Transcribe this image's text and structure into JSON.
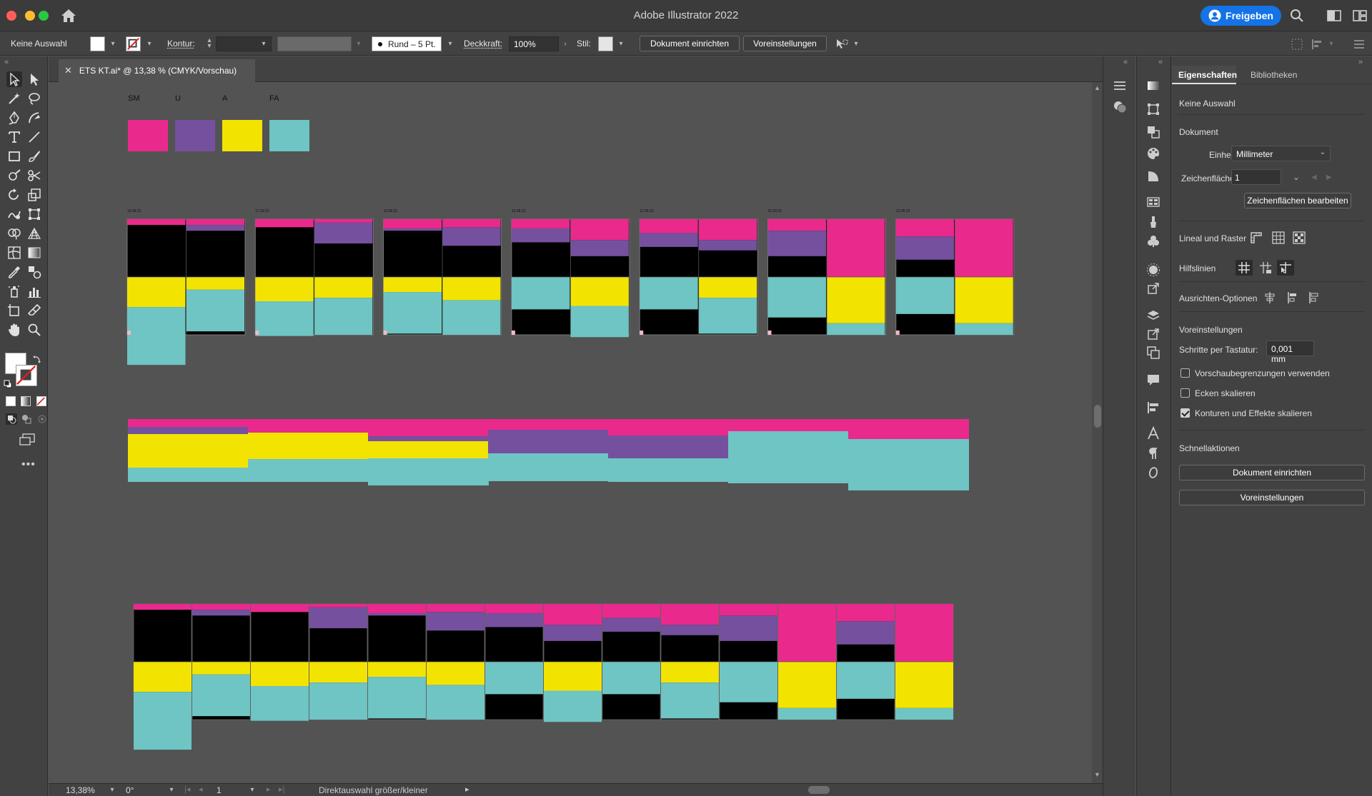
{
  "window": {
    "title": "Adobe Illustrator 2022",
    "share_label": "Freigeben"
  },
  "controlbar": {
    "selection": "Keine Auswahl",
    "stroke_label": "Kontur:",
    "brush_label": "Rund – 5 Pt.",
    "opacity_label": "Deckkraft:",
    "opacity_value": "100%",
    "style_label": "Stil:",
    "doc_setup_label": "Dokument einrichten",
    "prefs_label": "Voreinstellungen"
  },
  "document": {
    "tab_label": "ETS KT.ai* @ 13,38 % (CMYK/Vorschau)"
  },
  "colors": {
    "magenta": "#e9298c",
    "purple": "#75509e",
    "yellow": "#f2e400",
    "cyan": "#6ec5c3",
    "black": "#000000"
  },
  "artwork": {
    "swatch_labels": [
      "SM",
      "U",
      "A",
      "FA"
    ],
    "artboard_labels": [
      "19.08.22",
      "17.09.22",
      "15.08.22",
      "15.08.22",
      "12.08.22",
      "15.08.22",
      "13.08.22"
    ],
    "artboards": [
      [
        [
          0.05,
          0.05,
          0.26,
          0.5
        ],
        [
          0.05,
          0.1,
          0.11,
          0.36
        ]
      ],
      [
        [
          0.07,
          0.07,
          0.21,
          0.3
        ],
        [
          0.03,
          0.21,
          0.18,
          0.32
        ]
      ],
      [
        [
          0.08,
          0.1,
          0.13,
          0.36
        ],
        [
          0.07,
          0.23,
          0.2,
          0.3
        ]
      ],
      [
        [
          0.08,
          0.2,
          0,
          0.28
        ],
        [
          0.18,
          0.32,
          0.25,
          0.27
        ]
      ],
      [
        [
          0.12,
          0.24,
          0,
          0.28
        ],
        [
          0.18,
          0.27,
          0.18,
          0.31
        ]
      ],
      [
        [
          0.1,
          0.32,
          0,
          0.35
        ],
        [
          0.5,
          0.5,
          0.4,
          0.1
        ]
      ],
      [
        [
          0.15,
          0.35,
          0,
          0.32
        ],
        [
          0.5,
          0.5,
          0.4,
          0.1
        ]
      ]
    ],
    "bands": [
      {
        "m": 0.11,
        "p": 0.1,
        "y": 0.47,
        "c": 0.2
      },
      {
        "m": 0.19,
        "p": 0,
        "y": 0.37,
        "c": 0.32
      },
      {
        "m": 0.24,
        "p": 0.07,
        "y": 0.24,
        "c": 0.38
      },
      {
        "m": 0.15,
        "p": 0.33,
        "y": 0,
        "c": 0.39
      },
      {
        "m": 0.23,
        "p": 0.32,
        "y": 0,
        "c": 0.33
      },
      {
        "m": 0.17,
        "p": 0,
        "y": 0,
        "c": 0.73
      },
      {
        "m": 0.28,
        "p": 0,
        "y": 0,
        "c": 0.72
      }
    ]
  },
  "statusbar": {
    "zoom": "13,38%",
    "rotation": "0°",
    "artboard": "1",
    "tool_hint": "Direktauswahl größer/kleiner"
  },
  "props": {
    "tab_properties": "Eigenschaften",
    "tab_libraries": "Bibliotheken",
    "selection": "Keine Auswahl",
    "section_document": "Dokument",
    "units_label": "Einheit:",
    "units_value": "Millimeter",
    "artboard_label": "Zeichenfläche:",
    "artboard_value": "1",
    "edit_artboards": "Zeichenflächen bearbeiten",
    "rulers_grids": "Lineal und Raster",
    "guides": "Hilfslinien",
    "align_options": "Ausrichten-Optionen",
    "section_prefs": "Voreinstellungen",
    "keyboard_inc_label": "Schritte per Tastatur:",
    "keyboard_inc_value": "0,001 mm",
    "use_preview_bounds": "Vorschaubegrenzungen verwenden",
    "scale_corners": "Ecken skalieren",
    "scale_strokes": "Konturen und Effekte skalieren",
    "section_quick": "Schnellaktionen",
    "quick_doc_setup": "Dokument einrichten",
    "quick_prefs": "Voreinstellungen"
  }
}
